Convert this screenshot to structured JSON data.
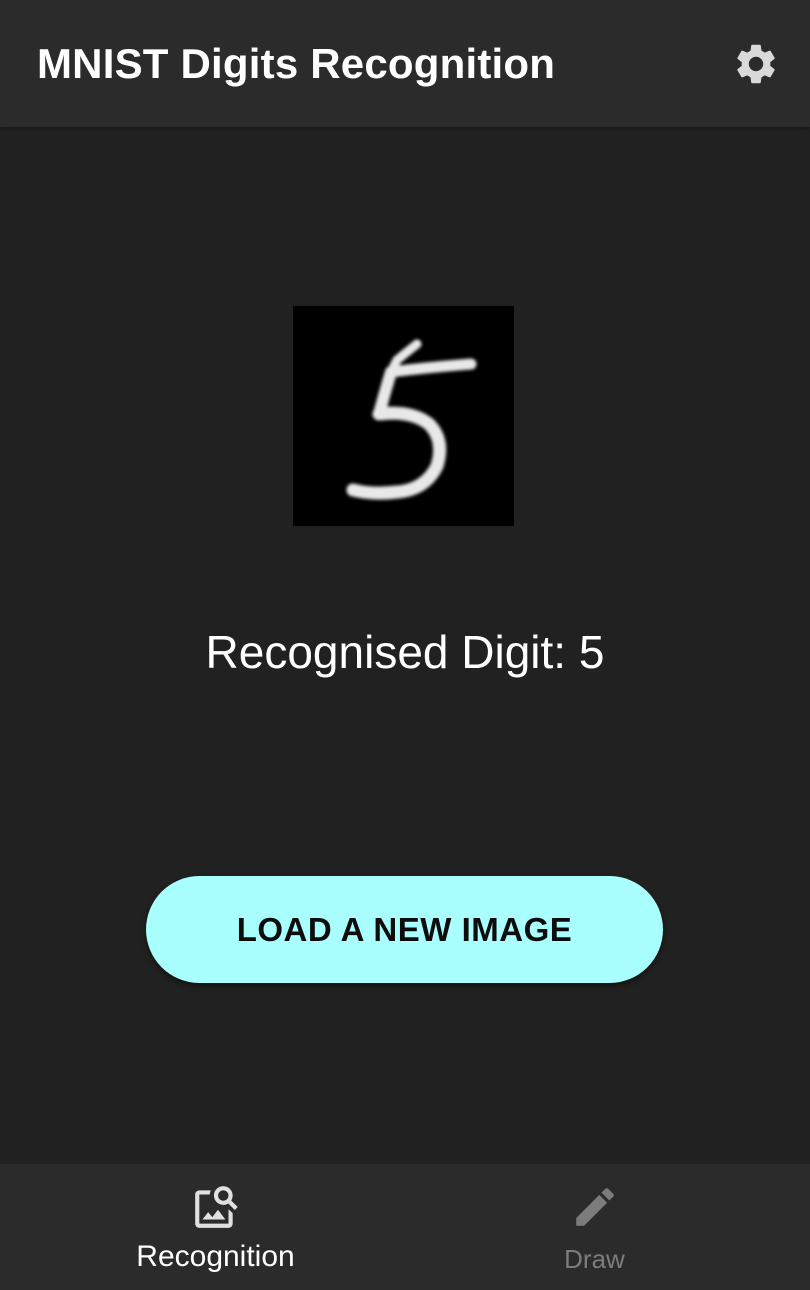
{
  "app_bar": {
    "title": "MNIST Digits Recognition",
    "settings_icon": "gear-icon"
  },
  "main": {
    "digit_image_alt": "handwritten digit",
    "result_text": "Recognised Digit: 5",
    "load_button_label": "LOAD A NEW IMAGE"
  },
  "bottom_nav": {
    "items": [
      {
        "label": "Recognition",
        "icon": "image-search-icon",
        "active": true
      },
      {
        "label": "Draw",
        "icon": "pencil-icon",
        "active": false
      }
    ]
  },
  "colors": {
    "background": "#212121",
    "bar": "#2b2b2b",
    "accent": "#a9fffd",
    "inactive": "#7c7c7c"
  }
}
